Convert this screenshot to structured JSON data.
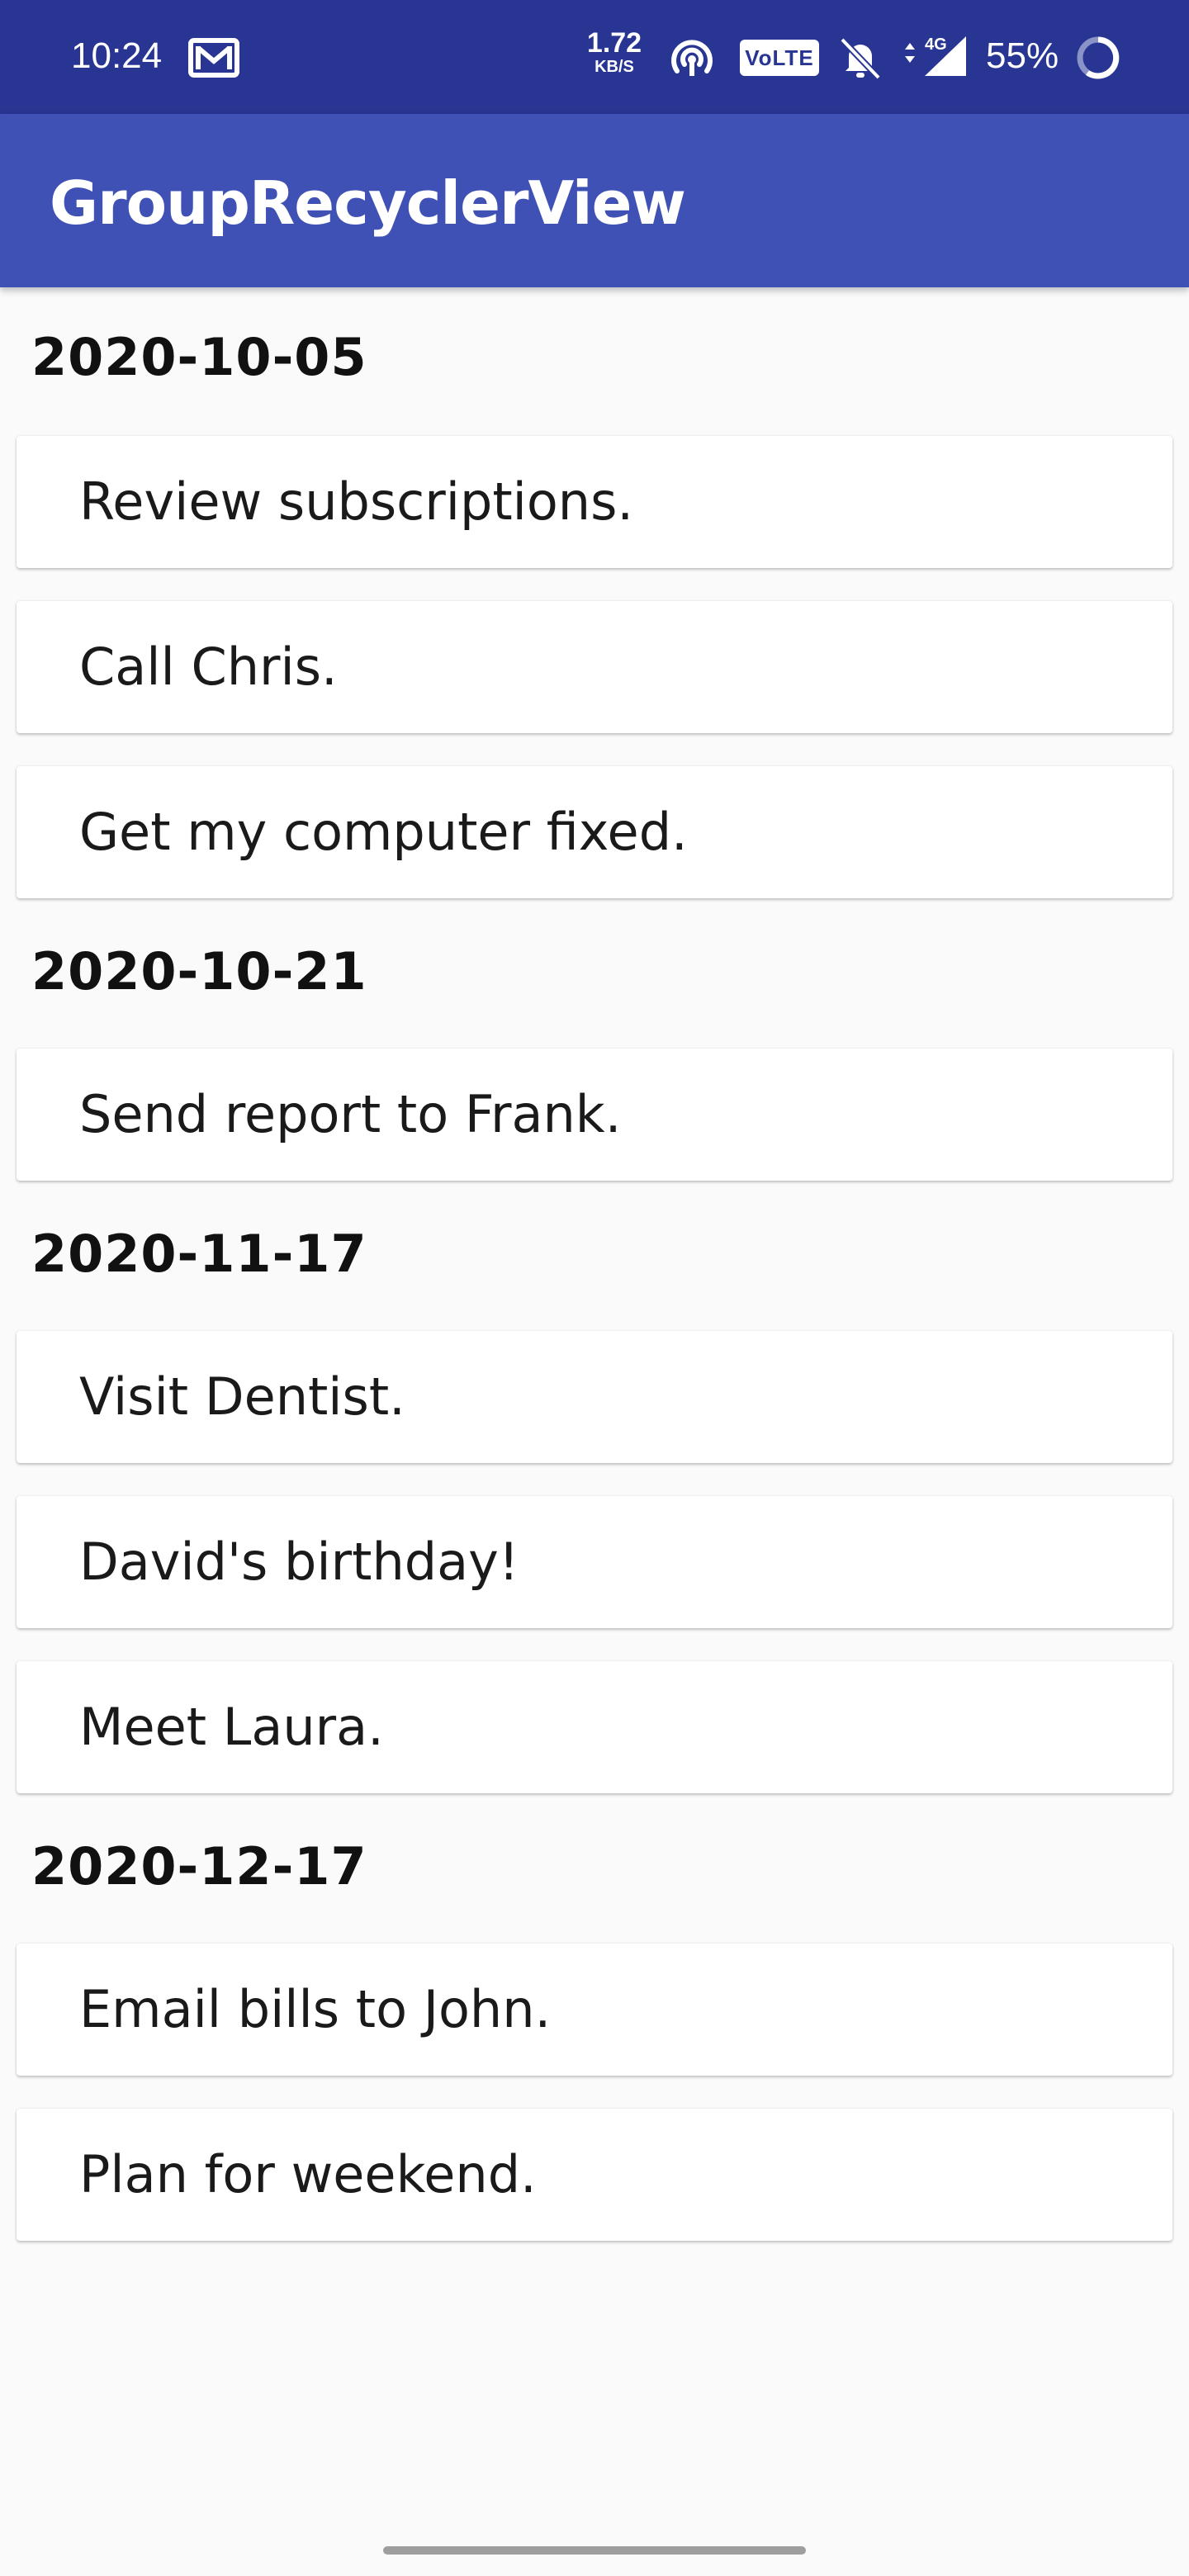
{
  "status_bar": {
    "time": "10:24",
    "net_speed_value": "1.72",
    "net_speed_unit": "KB/S",
    "volte_label": "VoLTE",
    "network_type": "4G",
    "battery_percent": "55%",
    "icons": [
      "gmail-icon",
      "hotspot-icon",
      "volte-icon",
      "mute-icon",
      "signal-icon",
      "battery-icon"
    ],
    "background_color": "#283593"
  },
  "app_bar": {
    "title": "GroupRecyclerView",
    "background_color": "#3f51b5"
  },
  "groups": [
    {
      "date": "2020-10-05",
      "items": [
        "Review subscriptions.",
        "Call Chris.",
        "Get my computer fixed."
      ]
    },
    {
      "date": "2020-10-21",
      "items": [
        "Send report to Frank."
      ]
    },
    {
      "date": "2020-11-17",
      "items": [
        "Visit Dentist.",
        "David's birthday!",
        "Meet Laura."
      ]
    },
    {
      "date": "2020-12-17",
      "items": [
        "Email bills to John.",
        "Plan for weekend."
      ]
    }
  ]
}
